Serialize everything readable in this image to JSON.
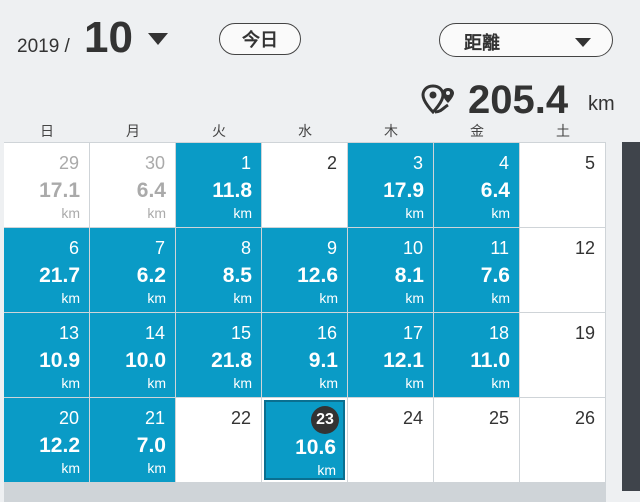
{
  "header": {
    "year": "2019 /",
    "month": "10",
    "today_label": "今日",
    "metric_label": "距離",
    "total_value": "205.4",
    "total_unit": "km"
  },
  "weekdays": [
    "日",
    "月",
    "火",
    "水",
    "木",
    "金",
    "土"
  ],
  "unit": "km",
  "calendar": [
    {
      "day": "29",
      "dist": "17.1",
      "state": "outside"
    },
    {
      "day": "30",
      "dist": "6.4",
      "state": "outside"
    },
    {
      "day": "1",
      "dist": "11.8",
      "state": "active"
    },
    {
      "day": "2",
      "dist": "",
      "state": "empty"
    },
    {
      "day": "3",
      "dist": "17.9",
      "state": "active"
    },
    {
      "day": "4",
      "dist": "6.4",
      "state": "active"
    },
    {
      "day": "5",
      "dist": "",
      "state": "empty"
    },
    {
      "day": "6",
      "dist": "21.7",
      "state": "active"
    },
    {
      "day": "7",
      "dist": "6.2",
      "state": "active"
    },
    {
      "day": "8",
      "dist": "8.5",
      "state": "active"
    },
    {
      "day": "9",
      "dist": "12.6",
      "state": "active"
    },
    {
      "day": "10",
      "dist": "8.1",
      "state": "active"
    },
    {
      "day": "11",
      "dist": "7.6",
      "state": "active"
    },
    {
      "day": "12",
      "dist": "",
      "state": "empty"
    },
    {
      "day": "13",
      "dist": "10.9",
      "state": "active"
    },
    {
      "day": "14",
      "dist": "10.0",
      "state": "active"
    },
    {
      "day": "15",
      "dist": "21.8",
      "state": "active"
    },
    {
      "day": "16",
      "dist": "9.1",
      "state": "active"
    },
    {
      "day": "17",
      "dist": "12.1",
      "state": "active"
    },
    {
      "day": "18",
      "dist": "11.0",
      "state": "active"
    },
    {
      "day": "19",
      "dist": "",
      "state": "empty"
    },
    {
      "day": "20",
      "dist": "12.2",
      "state": "active"
    },
    {
      "day": "21",
      "dist": "7.0",
      "state": "active"
    },
    {
      "day": "22",
      "dist": "",
      "state": "empty"
    },
    {
      "day": "23",
      "dist": "10.6",
      "state": "today"
    },
    {
      "day": "24",
      "dist": "",
      "state": "empty"
    },
    {
      "day": "25",
      "dist": "",
      "state": "empty"
    },
    {
      "day": "26",
      "dist": "",
      "state": "empty"
    }
  ],
  "colors": {
    "accent": "#0a9bc6",
    "text": "#333333"
  },
  "icons": {
    "total": "route-pin-icon",
    "caret": "caret-down-icon"
  }
}
